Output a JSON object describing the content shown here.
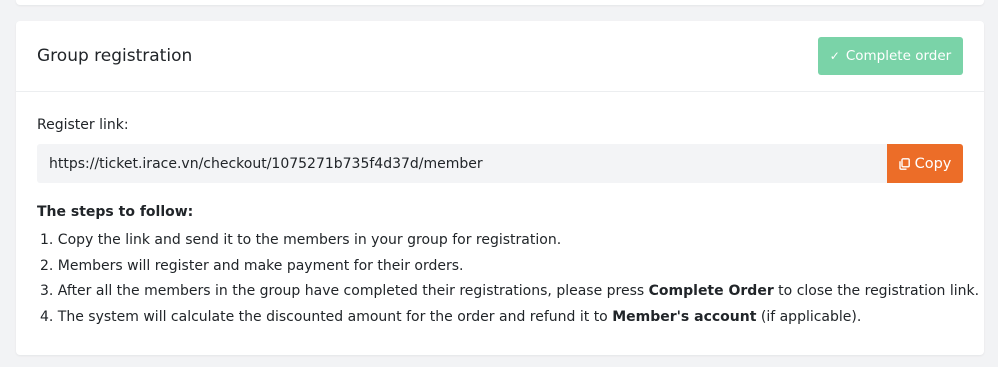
{
  "card": {
    "title": "Group registration",
    "complete_button": {
      "icon": "check-icon",
      "label": "Complete order",
      "color": "#7ad3a8"
    }
  },
  "register": {
    "label": "Register link:",
    "link_value": "https://ticket.irace.vn/checkout/1075271b735f4d37d/member",
    "copy_button": {
      "icon": "copy-icon",
      "label": "Copy",
      "color": "#ec6d28"
    }
  },
  "steps": {
    "title": "The steps to follow:",
    "items": [
      {
        "prefix": "1. Copy the link and send it to the members in your group for registration.",
        "bold": "",
        "suffix": ""
      },
      {
        "prefix": "2. Members will register and make payment for their orders.",
        "bold": "",
        "suffix": ""
      },
      {
        "prefix": "3. After all the members in the group have completed their registrations, please press ",
        "bold": "Complete Order",
        "suffix": " to close the registration link."
      },
      {
        "prefix": "4. The system will calculate the discounted amount for the order and refund it to ",
        "bold": "Member's account",
        "suffix": " (if applicable)."
      }
    ]
  }
}
